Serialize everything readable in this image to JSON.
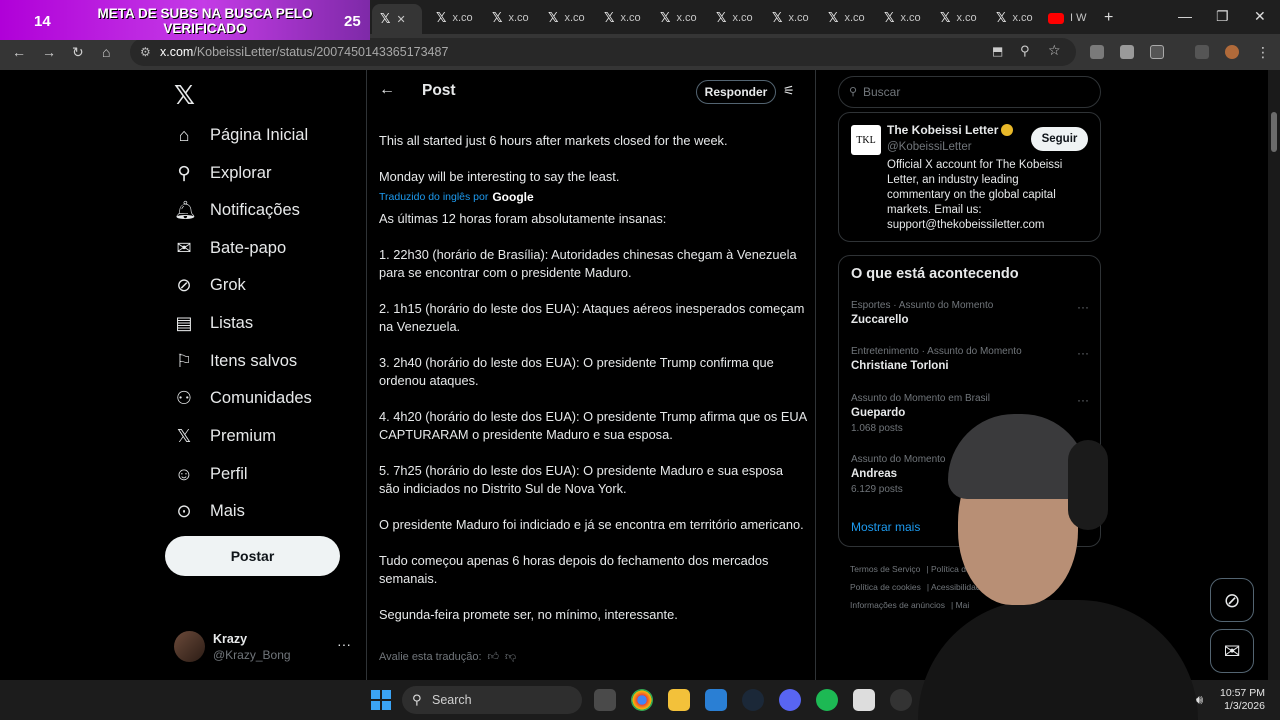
{
  "overlay": {
    "number_left": "14",
    "number_right": "25",
    "banner_text": "META DE SUBS NA BUSCA PELO VERIFICADO"
  },
  "browser": {
    "tabs": [
      "x.co",
      "x.co",
      "x.co",
      "x.co",
      "x.co",
      "x.co",
      "x.co",
      "x.co",
      "x.co",
      "x.co",
      "x.co"
    ],
    "last_tab": "I W",
    "new_tab": "+",
    "url_host": "x.com",
    "url_path": "/KobeissiLetter/status/2007450143365173487"
  },
  "nav": {
    "items": [
      {
        "label": "Página Inicial",
        "icon": "home-icon"
      },
      {
        "label": "Explorar",
        "icon": "search-icon"
      },
      {
        "label": "Notificações",
        "icon": "bell-icon"
      },
      {
        "label": "Bate-papo",
        "icon": "mail-icon"
      },
      {
        "label": "Grok",
        "icon": "grok-icon"
      },
      {
        "label": "Listas",
        "icon": "list-icon"
      },
      {
        "label": "Itens salvos",
        "icon": "bookmark-icon"
      },
      {
        "label": "Comunidades",
        "icon": "people-icon"
      },
      {
        "label": "Premium",
        "icon": "x-icon"
      },
      {
        "label": "Perfil",
        "icon": "person-icon"
      },
      {
        "label": "Mais",
        "icon": "more-circle-icon"
      }
    ],
    "post_button": "Postar",
    "user": {
      "name": "Krazy",
      "handle": "@Krazy_Bong"
    }
  },
  "post": {
    "header_title": "Post",
    "reply_button": "Responder",
    "original_lines": [
      "This all started just 6 hours after markets closed for the week.",
      "Monday will be interesting to say the least."
    ],
    "translated_label": "Traduzido do inglês por",
    "translated_brand": "Google",
    "translated_lines": [
      "As últimas 12 horas foram absolutamente insanas:",
      "1. 22h30 (horário de Brasília): Autoridades chinesas chegam à Venezuela para se encontrar com o presidente Maduro.",
      "2. 1h15 (horário do leste dos EUA): Ataques aéreos inesperados começam na Venezuela.",
      "3. 2h40 (horário do leste dos EUA): O presidente Trump confirma que ordenou ataques.",
      "4. 4h20 (horário do leste dos EUA): O presidente Trump afirma que os EUA CAPTURARAM o presidente Maduro e sua esposa.",
      "5. 7h25 (horário do leste dos EUA): O presidente Maduro e sua esposa são indiciados no Distrito Sul de Nova York.",
      "O presidente Maduro foi indiciado e já se encontra em território americano.",
      "Tudo começou apenas 6 horas depois do fechamento dos mercados semanais.",
      "Segunda-feira promete ser, no mínimo, interessante."
    ],
    "rate_label": "Avalie esta tradução:"
  },
  "sidebar": {
    "search_placeholder": "Buscar",
    "profile": {
      "logo_text": "TKL",
      "name": "The Kobeissi Letter",
      "handle": "@KobeissiLetter",
      "follow": "Seguir",
      "bio": "Official X account for The Kobeissi Letter, an industry leading commentary on the global capital markets. Email us: support@thekobeissiletter.com"
    },
    "trends_title": "O que está acontecendo",
    "trends": [
      {
        "category": "Esportes · Assunto do Momento",
        "name": "Zuccarello",
        "count": ""
      },
      {
        "category": "Entretenimento · Assunto do Momento",
        "name": "Christiane Torloni",
        "count": ""
      },
      {
        "category": "Assunto do Momento em Brasil",
        "name": "Guepardo",
        "count": "1.068 posts"
      },
      {
        "category": "Assunto do Momento",
        "name": "Andreas",
        "count": "6.129 posts"
      }
    ],
    "show_more": "Mostrar mais",
    "footer": [
      "Termos de Serviço",
      "Política de P",
      "Política de cookies",
      "Acessibilidade",
      "Informações de anúncios",
      "Mai"
    ]
  },
  "taskbar": {
    "search": "Search",
    "time": "10:57 PM",
    "date": "1/3/2026"
  },
  "colors": {
    "accent": "#1d9bf0",
    "banner": "#c43be6",
    "verified": "#e8b829"
  }
}
